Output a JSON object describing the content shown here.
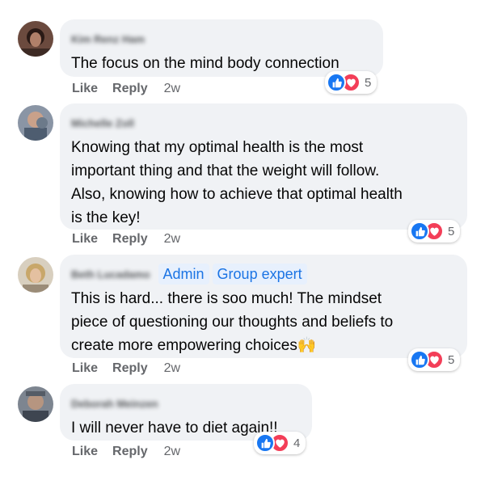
{
  "comments": [
    {
      "author": "Kim Renz Ham",
      "badges": [],
      "text_lines": [
        "The focus on the mind body connection"
      ],
      "actions": {
        "like": "Like",
        "reply": "Reply",
        "time": "2w"
      },
      "reactions": {
        "count": "5"
      }
    },
    {
      "author": "Michelle Zoll",
      "badges": [],
      "text_lines": [
        "Knowing that my optimal health is the most",
        "important thing and that the weight will follow.",
        "Also, knowing how to achieve that optimal health",
        "is the key!"
      ],
      "actions": {
        "like": "Like",
        "reply": "Reply",
        "time": "2w"
      },
      "reactions": {
        "count": "5"
      }
    },
    {
      "author": "Beth Lucadamo",
      "badges": [
        "Admin",
        "Group expert"
      ],
      "text_lines": [
        "This is hard... there is soo much! The mindset",
        "piece of questioning our thoughts and beliefs to",
        "create more empowering choices🙌"
      ],
      "actions": {
        "like": "Like",
        "reply": "Reply",
        "time": "2w"
      },
      "reactions": {
        "count": "5"
      }
    },
    {
      "author": "Deborah Meinzen",
      "badges": [],
      "text_lines": [
        "I will never have to diet again!!"
      ],
      "actions": {
        "like": "Like",
        "reply": "Reply",
        "time": "2w"
      },
      "reactions": {
        "count": "4"
      }
    }
  ],
  "colors": {
    "bubble": "#f0f2f5",
    "like_blue": "#1877f2",
    "love_red": "#f33e58",
    "meta_gray": "#65676b",
    "badge_blue": "#1b74e4"
  }
}
